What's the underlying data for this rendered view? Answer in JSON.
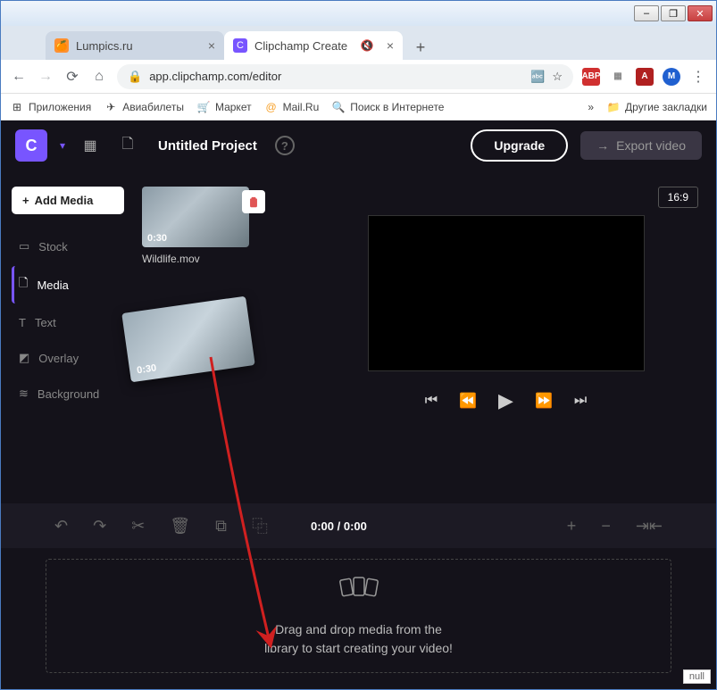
{
  "window": {
    "min": "–",
    "max": "❐",
    "close": "✕"
  },
  "tabs": {
    "inactive": {
      "title": "Lumpics.ru",
      "favletter": "🍊"
    },
    "active": {
      "title": "Clipchamp Create",
      "favletter": "C",
      "mute": "🔇"
    }
  },
  "address": {
    "url": "app.clipchamp.com/editor",
    "lock": "🔒",
    "translate": "🔤",
    "star": "☆"
  },
  "extensions": {
    "abp": "ABP",
    "menu": "⋮"
  },
  "bookmarks": {
    "apps": "Приложения",
    "avia": "Авиабилеты",
    "market": "Маркет",
    "mail": "Mail.Ru",
    "search": "Поиск в Интернете",
    "more": "»",
    "other": "Другие закладки"
  },
  "header": {
    "logo": "C",
    "project": "Untitled Project",
    "help": "?",
    "upgrade": "Upgrade",
    "export": "Export video"
  },
  "sidebar": {
    "add": "Add Media",
    "items": [
      {
        "label": "Stock"
      },
      {
        "label": "Media"
      },
      {
        "label": "Text"
      },
      {
        "label": "Overlay"
      },
      {
        "label": "Background"
      }
    ]
  },
  "clip": {
    "duration": "0:30",
    "name": "Wildlife.mov"
  },
  "ghost": {
    "duration": "0:30"
  },
  "preview": {
    "aspect": "16:9"
  },
  "timeline": {
    "time": "0:00 / 0:00"
  },
  "dropzone": {
    "line1": "Drag and drop media from the",
    "line2": "library to start creating your video!"
  },
  "null": "null"
}
